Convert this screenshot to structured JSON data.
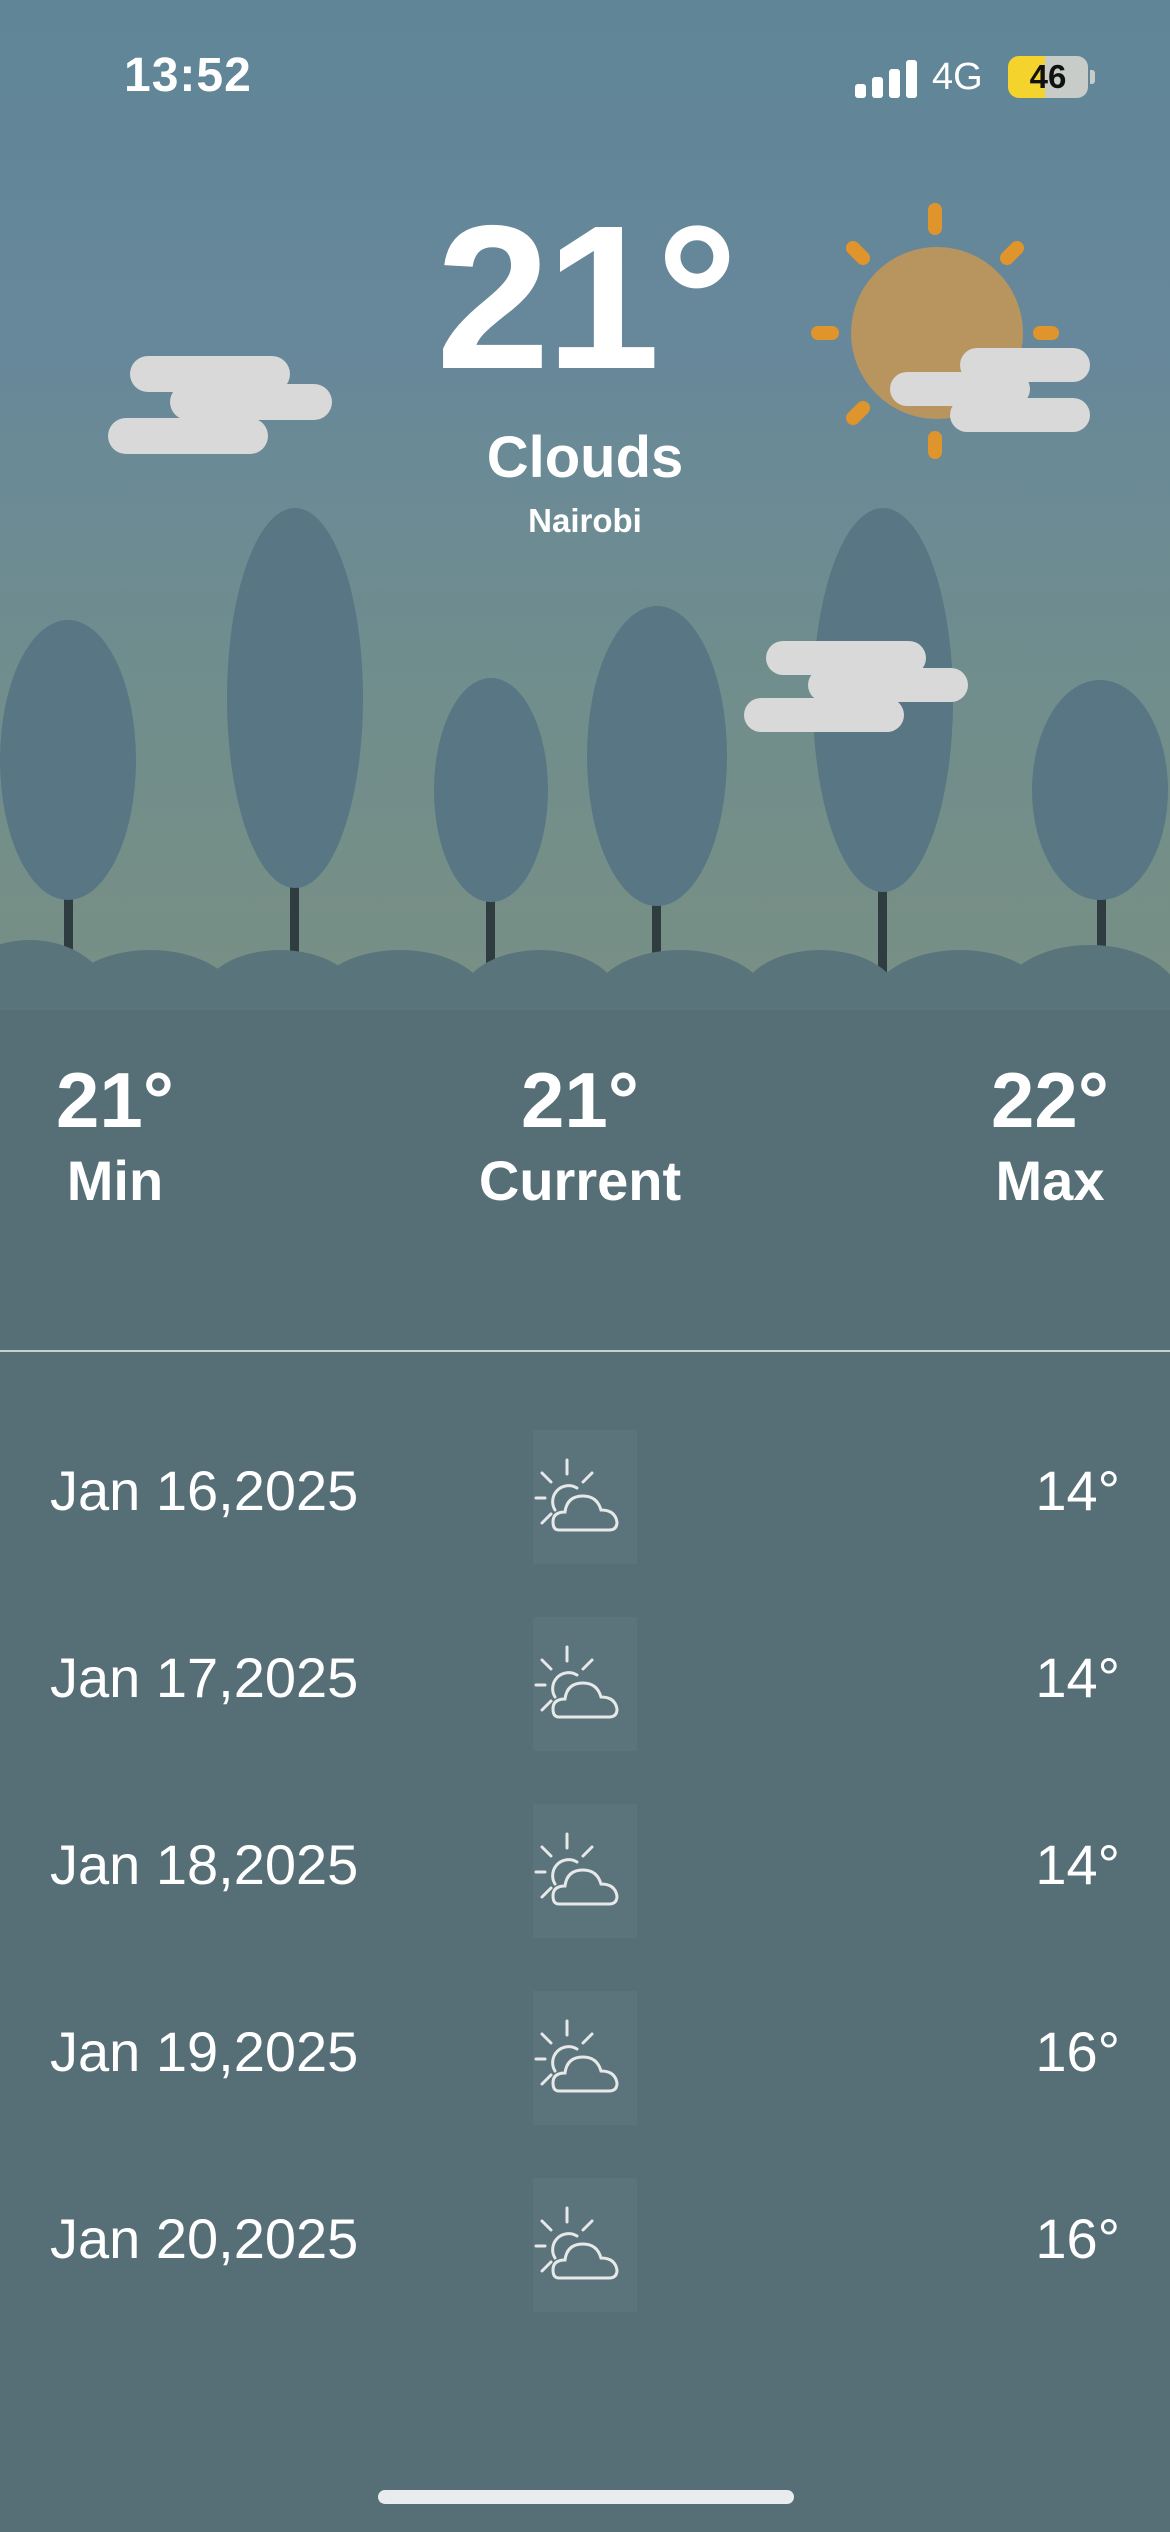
{
  "status_bar": {
    "time": "13:52",
    "network": "4G",
    "battery": "46"
  },
  "current": {
    "temperature": "21°",
    "condition": "Clouds",
    "city": "Nairobi"
  },
  "stats": {
    "min": {
      "value": "21°",
      "label": "Min"
    },
    "current": {
      "value": "21°",
      "label": "Current"
    },
    "max": {
      "value": "22°",
      "label": "Max"
    }
  },
  "forecast": [
    {
      "date": "Jan 16,2025",
      "icon": "partly-cloudy-icon",
      "temp": "14°"
    },
    {
      "date": "Jan 17,2025",
      "icon": "partly-cloudy-icon",
      "temp": "14°"
    },
    {
      "date": "Jan 18,2025",
      "icon": "partly-cloudy-icon",
      "temp": "14°"
    },
    {
      "date": "Jan 19,2025",
      "icon": "partly-cloudy-icon",
      "temp": "16°"
    },
    {
      "date": "Jan 20,2025",
      "icon": "partly-cloudy-icon",
      "temp": "16°"
    }
  ],
  "colors": {
    "background": "#566f77",
    "sun": "#d39a4a",
    "sun_rays": "#e0952c",
    "cloud": "#d9d9d9",
    "tree": "#577580",
    "battery": "#f4d42c"
  }
}
